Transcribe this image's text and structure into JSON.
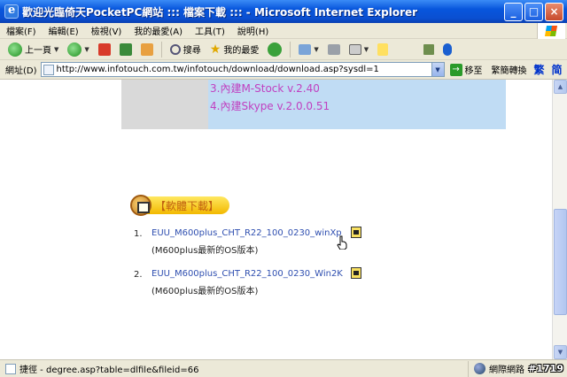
{
  "window": {
    "title": "歡迎光臨倚天PocketPC網站 ::: 檔案下載 ::: - Microsoft Internet Explorer",
    "minimize": "_",
    "maximize": "□",
    "close": "×"
  },
  "menu": {
    "items": [
      "檔案(F)",
      "編輯(E)",
      "檢視(V)",
      "我的最愛(A)",
      "工具(T)",
      "說明(H)"
    ]
  },
  "toolbar": {
    "back_label": "上一頁",
    "search_label": "搜尋",
    "favorites_label": "我的最愛"
  },
  "address": {
    "label": "網址(D)",
    "url": "http://www.infotouch.com.tw/infotouch/download/download.asp?sysdl=1",
    "go_label": "移至",
    "lang_label": "繁簡轉換",
    "trad_label": "繁",
    "simp_label": "简"
  },
  "features": [
    "3.內建M-Stock  v.2.40",
    "4.內建Skype  v.2.0.0.51"
  ],
  "download": {
    "title": "【軟體下載】",
    "items": [
      {
        "num": "1.",
        "name": "EUU_M600plus_CHT_R22_100_0230_winXp",
        "desc": "(M600plus最新的OS版本)"
      },
      {
        "num": "2.",
        "name": "EUU_M600plus_CHT_R22_100_0230_Win2K",
        "desc": "(M600plus最新的OS版本)"
      }
    ]
  },
  "status": {
    "text": "捷徑 - degree.asp?table=dlfile&fileid=66",
    "zone": "網際網路"
  },
  "watermark": "#1719",
  "colors": {
    "feature_text": "#c040c0",
    "link": "#2f4fb0",
    "download_title": "#c06010",
    "blue_panel": "#c0dcf4"
  }
}
